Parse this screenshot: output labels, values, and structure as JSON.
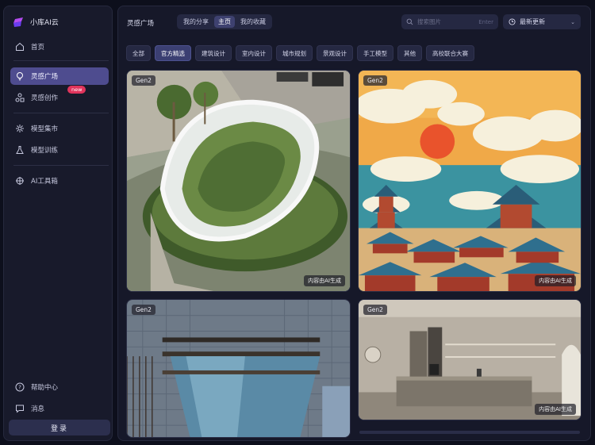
{
  "app": {
    "name": "小库AI云"
  },
  "nav": {
    "home": "首页",
    "plaza": "灵感广场",
    "create": "灵感创作",
    "create_badge": "new",
    "market": "模型集市",
    "training": "模型训练",
    "toolbox": "AI工具箱",
    "help": "帮助中心",
    "messages": "消息",
    "login": "登录"
  },
  "header": {
    "title": "灵感广场",
    "tabs": [
      "我的分享",
      "主页",
      "我的收藏"
    ],
    "active_tab": "主页",
    "search_placeholder": "搜索图片",
    "search_hint": "Enter",
    "sort_label": "最新更新"
  },
  "filters": [
    "全部",
    "官方精选",
    "建筑设计",
    "室内设计",
    "城市规划",
    "景观设计",
    "手工模型",
    "其他",
    "高校联合大赛"
  ],
  "active_filter": "官方精选",
  "cards": [
    {
      "tag": "Gen2",
      "note": "内容由AI生成",
      "subject": "rooftop-garden"
    },
    {
      "tag": "Gen2",
      "note": "内容由AI生成",
      "subject": "chinese-temple-city"
    },
    {
      "tag": "Gen2",
      "note": "",
      "subject": "glass-building"
    },
    {
      "tag": "Gen2",
      "note": "内容由AI生成",
      "subject": "kitchen-interior"
    }
  ],
  "colors": {
    "accent": "#4e4c8f",
    "badge": "#e0345c",
    "background": "#0d0f1c"
  }
}
